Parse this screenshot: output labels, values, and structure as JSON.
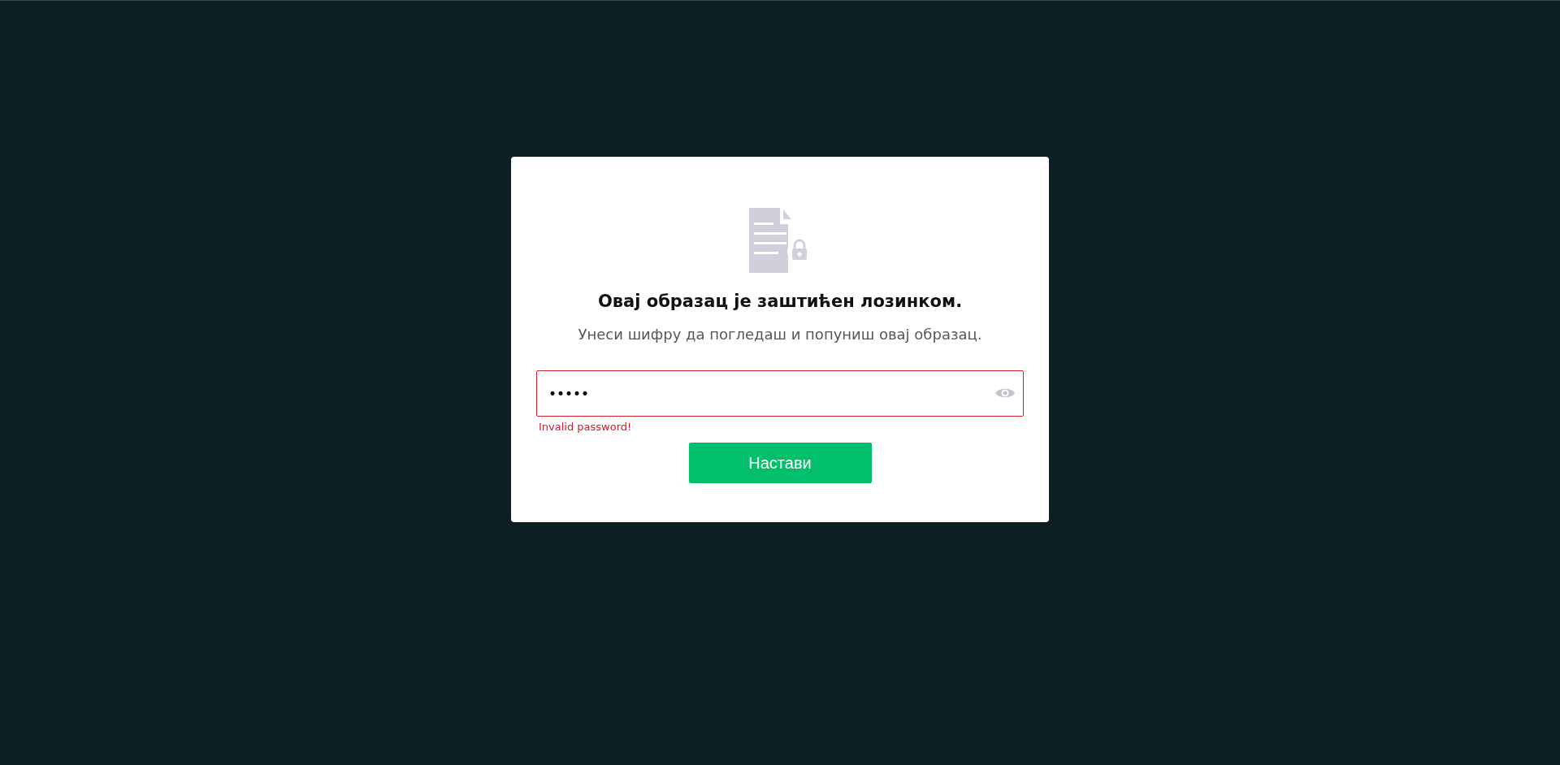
{
  "dialog": {
    "title": "Овај образац је заштићен лозинком.",
    "subtitle": "Унеси шифру да погледаш и попуниш овај образац.",
    "password_field": {
      "value": "•••••",
      "invalid": true
    },
    "error": "Invalid password!",
    "button": "Настави"
  }
}
